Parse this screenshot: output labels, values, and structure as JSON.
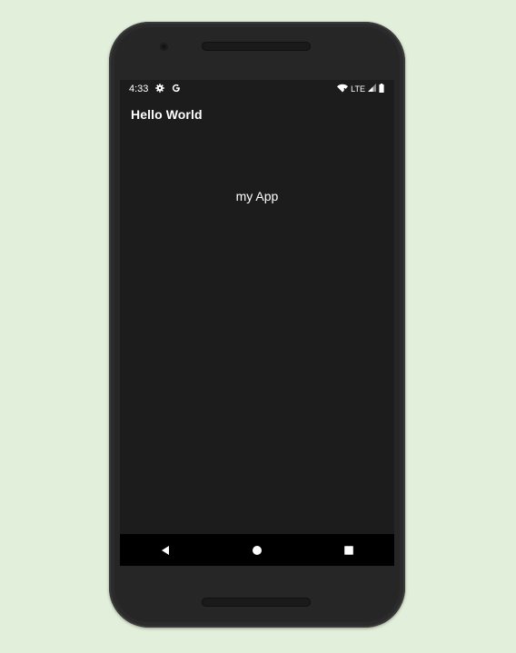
{
  "status_bar": {
    "time": "4:33",
    "left_icons": [
      "gear-icon",
      "google-icon"
    ],
    "network_label": "LTE",
    "right_icons": [
      "wifi-icon",
      "signal-icon",
      "battery-icon"
    ]
  },
  "app": {
    "title": "Hello World",
    "content_text": "my App"
  },
  "nav_bar": {
    "buttons": [
      "back-icon",
      "home-icon",
      "recents-icon"
    ]
  },
  "colors": {
    "background": "#e2efda",
    "screen": "#1c1c1d",
    "nav_bar": "#000000",
    "text": "#ffffff"
  }
}
